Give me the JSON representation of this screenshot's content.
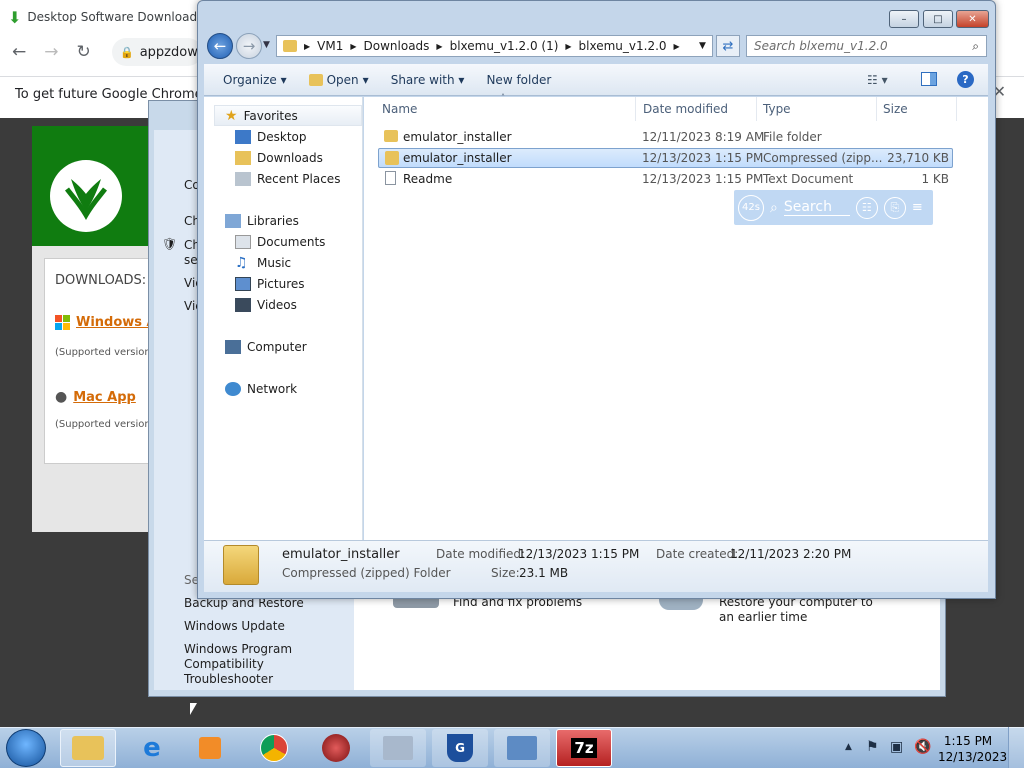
{
  "chrome": {
    "tab_title": "Desktop Software Download",
    "url": "appzdow",
    "info_bar": "To get future Google Chrome u"
  },
  "webpage": {
    "downloads_label": "DOWNLOADS:",
    "windows_link": "Windows A",
    "supported1": "(Supported version",
    "mac_link": "Mac App",
    "supported2": "(Supported version"
  },
  "control_panel": {
    "left_items": [
      "Co",
      "Ch",
      "Ch",
      "set",
      "Vie",
      "Vie"
    ],
    "see_also": "Se",
    "links": [
      "Backup and Restore",
      "Windows Update",
      "Windows Program Compatibility Troubleshooter"
    ],
    "find_fix": "Find and fix problems",
    "restore": "Restore your computer to an earlier time"
  },
  "explorer": {
    "breadcrumb": [
      "VM1",
      "Downloads",
      "blxemu_v1.2.0 (1)",
      "blxemu_v1.2.0"
    ],
    "search_placeholder": "Search blxemu_v1.2.0",
    "toolbar": {
      "organize": "Organize",
      "open": "Open",
      "share": "Share with",
      "new_folder": "New folder"
    },
    "nav": {
      "favorites": "Favorites",
      "desktop": "Desktop",
      "downloads": "Downloads",
      "recent": "Recent Places",
      "libraries": "Libraries",
      "documents": "Documents",
      "music": "Music",
      "pictures": "Pictures",
      "videos": "Videos",
      "computer": "Computer",
      "network": "Network"
    },
    "columns": {
      "name": "Name",
      "date": "Date modified",
      "type": "Type",
      "size": "Size"
    },
    "files": [
      {
        "name": "emulator_installer",
        "date": "12/11/2023 8:19 AM",
        "type": "File folder",
        "size": ""
      },
      {
        "name": "emulator_installer",
        "date": "12/13/2023 1:15 PM",
        "type": "Compressed (zipp...",
        "size": "23,710 KB"
      },
      {
        "name": "Readme",
        "date": "12/13/2023 1:15 PM",
        "type": "Text Document",
        "size": "1 KB"
      }
    ],
    "details": {
      "name": "emulator_installer",
      "kind": "Compressed (zipped) Folder",
      "date_modified_label": "Date modified:",
      "date_modified": "12/13/2023 1:15 PM",
      "date_created_label": "Date created:",
      "date_created": "12/11/2023 2:20 PM",
      "size_label": "Size:",
      "size": "23.1 MB"
    }
  },
  "overlay": {
    "badge": "42s",
    "search": "Search"
  },
  "taskbar": {
    "time": "1:15 PM",
    "date": "12/13/2023",
    "app_7z": "7z"
  }
}
